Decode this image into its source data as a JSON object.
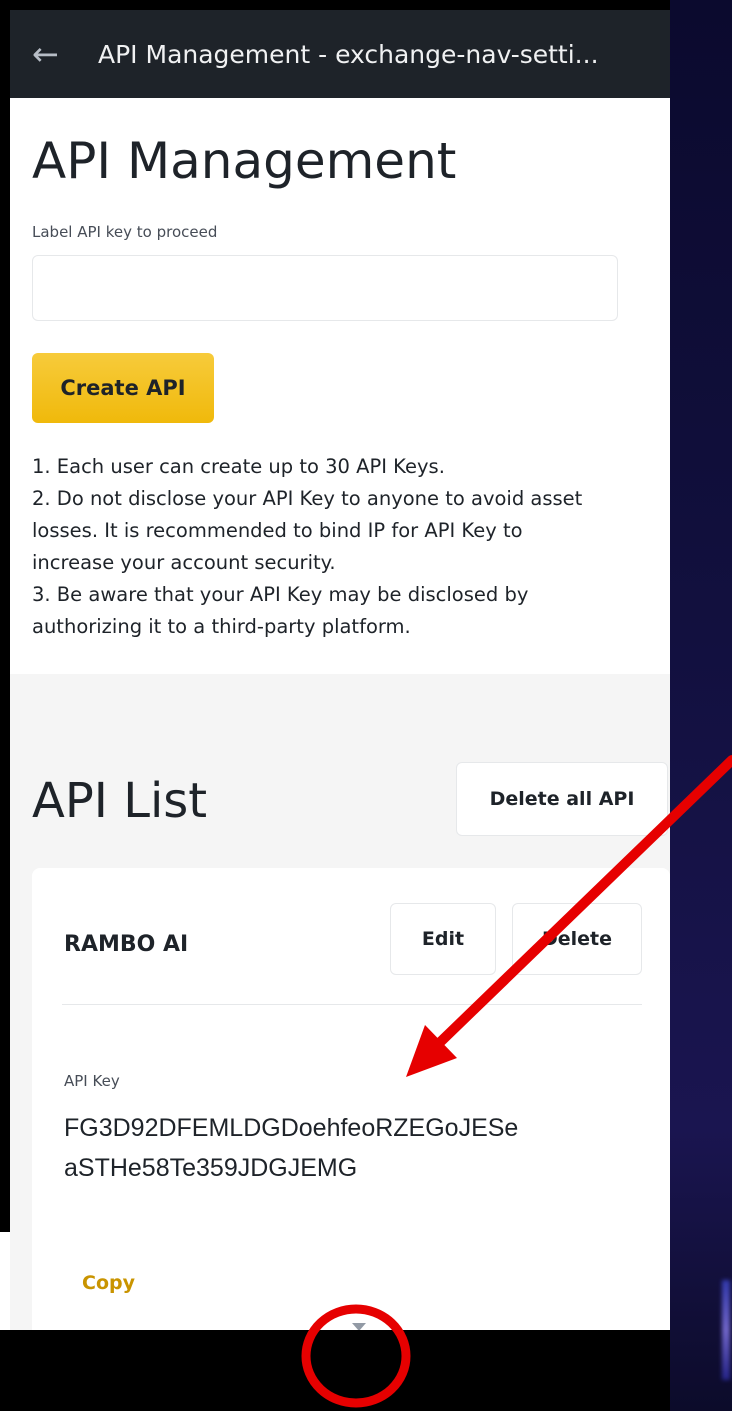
{
  "header": {
    "title": "API Management - exchange-nav-setti...",
    "back_icon": "arrow-left-icon"
  },
  "page": {
    "heading": "API Management",
    "input_label": "Label API key to proceed",
    "input_value": "",
    "create_button": "Create API",
    "notes": [
      "1. Each user can create up to 30 API Keys.",
      "2. Do not disclose your API Key to anyone to avoid asset",
      "losses. It is recommended to bind IP for API Key to",
      "increase your account security.",
      "3. Be aware that your API Key may be disclosed by",
      "authorizing it to a third-party platform."
    ]
  },
  "api_list": {
    "heading": "API List",
    "delete_all_button": "Delete all API",
    "items": [
      {
        "name": "RAMBO AI",
        "edit_button": "Edit",
        "delete_button": "Delete",
        "api_key_label": "API Key",
        "api_key_lines": [
          "FG3D92DFEMLDGDoehfeoRZEGoJESe",
          "aSTHe58Te359JDGJEMG"
        ],
        "copy_label": "Copy",
        "expand_icon": "chevron-down-icon"
      }
    ]
  },
  "colors": {
    "topbar": "#1e2329",
    "accent_yellow": "#f0b90b",
    "copy_gold": "#c99400",
    "annotation_red": "#e60000",
    "page_bg": "#ffffff",
    "section_gray": "#f5f5f5"
  }
}
